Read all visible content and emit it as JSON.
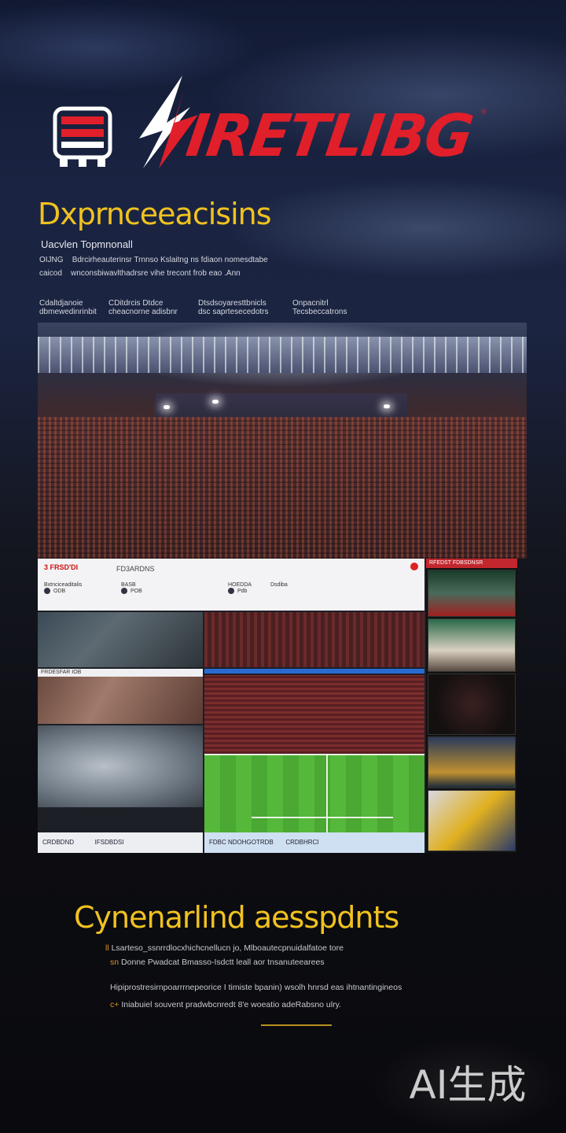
{
  "brand": {
    "wordmark": "IRETLIBG",
    "tm": "®"
  },
  "hero": {
    "headline": "Dxprnceeacisins",
    "subhead": "Uacvlen Topmnonall",
    "intro_lines": [
      {
        "tag": "OIJNG",
        "text": "Bdrcirheauterinsr Trnnso Kslaitng ns fdiaon nomesdtabe"
      },
      {
        "tag": "caicod",
        "text": "wnconsbiwavlthadrsre vihe trecont frob eao .Ann"
      }
    ],
    "features": [
      {
        "title": "Cdaltdjanoie",
        "desc": "dbmewedinrinbit"
      },
      {
        "title": "CDitdrcis Dtdce",
        "desc": "cheacnorne adisbnr"
      },
      {
        "title": "Dtsdsoyaresttbnicls",
        "desc": "dsc saprtesecedotrs"
      },
      {
        "title": "Onpacnitrl",
        "desc": "Tecsbeccatrons"
      }
    ]
  },
  "dashboard": {
    "logo": "3 FRSD'DI",
    "nav": "FD3ARDNS",
    "stats": [
      {
        "label": "Bxtnciceaditalis",
        "value": "ODB"
      },
      {
        "label": "BASB",
        "value": "POB"
      },
      {
        "label": "HOEDDA",
        "value": "Pdb"
      },
      {
        "label": "Dsdiba",
        "value": ""
      }
    ],
    "side_header": "RFEDST FDBSDNSR",
    "panel_label": "FRDESFAR IOB",
    "footer_left": "CRDBDND",
    "footer_mid": "IFSDBDSI",
    "footer_right": "FDBC NDOHGOTRDB",
    "footer_far": "CRDBHRCI"
  },
  "section": {
    "title": "Cynenarlind aesspdnts",
    "lines": [
      {
        "tag": "ll",
        "text": "Lsarteso_ssnrrdlocxhichcnellucn jo, Mlboautecpnuidalfatoe tore"
      },
      {
        "tag": "sn",
        "text": "Donne Pwadcat Bmasso-Isdctt leall aor tnsanuteearees"
      },
      {
        "tag": "",
        "text": "Hipiprostresirnpoarrrnepeorice I timiste bpanin) wsolh hnrsd eas ihtnantingineos"
      },
      {
        "tag": "c+",
        "text": "Iniabuiel souvent pradwbcnredt 8'e woeatio adeRabsno ulry."
      }
    ]
  },
  "watermark": "AI生成",
  "colors": {
    "accent_yellow": "#f1c21f",
    "brand_red": "#e01f2a",
    "bg": "#0b0c12"
  }
}
